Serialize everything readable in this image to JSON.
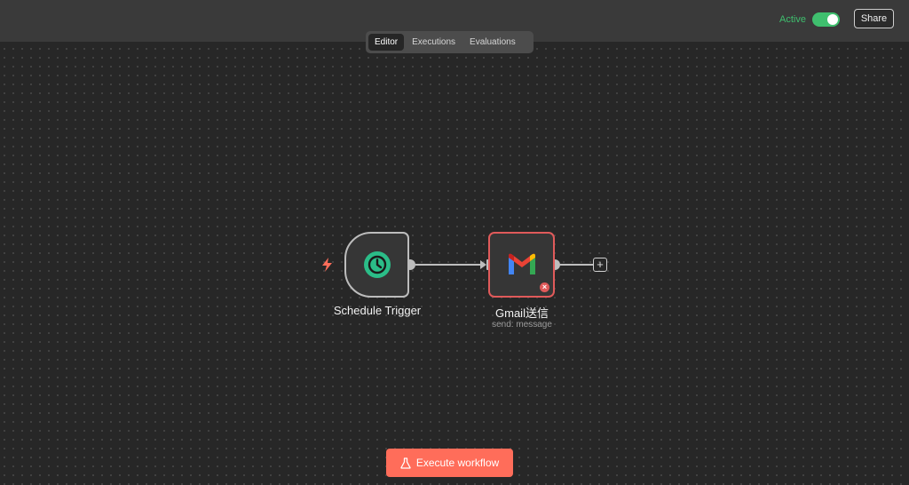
{
  "header": {
    "active_label": "Active",
    "active": true,
    "share_label": "Share",
    "accent_color": "#3fbf6e"
  },
  "tabs": [
    {
      "label": "Editor",
      "selected": true
    },
    {
      "label": "Executions",
      "selected": false
    },
    {
      "label": "Evaluations",
      "selected": false
    }
  ],
  "nodes": {
    "trigger": {
      "label": "Schedule Trigger",
      "icon": "clock-icon"
    },
    "gmail": {
      "label": "Gmail送信",
      "subtitle": "send: message",
      "icon": "gmail-icon",
      "status": "error"
    }
  },
  "actions": {
    "execute_label": "Execute workflow",
    "execute_color": "#ff6d5a"
  }
}
